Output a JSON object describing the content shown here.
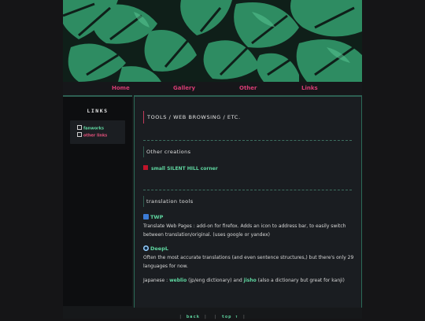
{
  "nav": {
    "items": [
      "Home",
      "Gallery",
      "Other",
      "Links"
    ]
  },
  "sidebar": {
    "title": "LINKS",
    "links": [
      {
        "label": "fanworks",
        "color": "#5fd6a0"
      },
      {
        "label": "other links",
        "color": "#e0507a"
      }
    ]
  },
  "main": {
    "heading": "TOOLS / WEB BROWSING / ETC.",
    "other_creations": {
      "heading": "Other creations",
      "item": "small SILENT HILL corner"
    },
    "translation": {
      "heading": "translation tools",
      "tools": [
        {
          "name": "TWP",
          "icon": "twp-icon",
          "description": "Translate Web Pages : add-on for firefox. Adds an icon to address bar, to easily switch between translation/original. (uses google or yandex)"
        },
        {
          "name": "DeepL",
          "icon": "deepl-icon",
          "description": "Often the most accurate translations (and even sentence structures,) but there's only 29 languages for now."
        }
      ],
      "japanese": {
        "prefix": "Japanese :",
        "link1": "weblio",
        "mid": "(jp/eng dictionary) and",
        "link2": "jisho",
        "suffix": "(also a dictionary but great for kanji)"
      }
    }
  },
  "footer": {
    "back": "back",
    "top": "top ↑"
  },
  "colors": {
    "accent_green": "#5fd6a0",
    "nav_pink": "#d63c73",
    "leaf": "#2f8f66"
  }
}
